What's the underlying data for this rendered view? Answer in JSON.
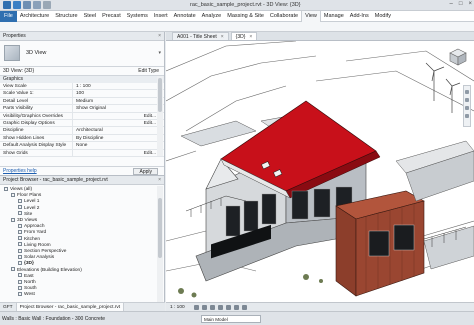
{
  "titlebar": {
    "title": "rac_basic_sample_project.rvt - 3D View: {3D}",
    "qat_colors": [
      "#2f6fb0",
      "#3a7fc4",
      "#6e8fb3",
      "#8aa1ba",
      "#9aa8b6"
    ],
    "win_min": "–",
    "win_max": "□",
    "win_close": "×"
  },
  "ribbon": {
    "tabs": [
      {
        "label": "File"
      },
      {
        "label": "Architecture"
      },
      {
        "label": "Structure"
      },
      {
        "label": "Steel"
      },
      {
        "label": "Precast"
      },
      {
        "label": "Systems"
      },
      {
        "label": "Insert"
      },
      {
        "label": "Annotate"
      },
      {
        "label": "Analyze"
      },
      {
        "label": "Massing & Site"
      },
      {
        "label": "Collaborate"
      },
      {
        "label": "View"
      },
      {
        "label": "Manage"
      },
      {
        "label": "Add-Ins"
      },
      {
        "label": "Modify"
      }
    ]
  },
  "properties": {
    "header": "Properties",
    "close": "×",
    "type_name": "3D View",
    "type_dropdown": "▾",
    "instance_label": "3D View: {3D}",
    "edit_type": "Edit Type",
    "group_graphics": "Graphics",
    "rows": [
      {
        "key": "View Scale",
        "value": "1 : 100"
      },
      {
        "key": "Scale Value 1:",
        "value": "100"
      },
      {
        "key": "Detail Level",
        "value": "Medium"
      },
      {
        "key": "Parts Visibility",
        "value": "Show Original"
      },
      {
        "key": "Visibility/Graphics Overrides",
        "value": "Edit..."
      },
      {
        "key": "Graphic Display Options",
        "value": "Edit..."
      },
      {
        "key": "Discipline",
        "value": "Architectural"
      },
      {
        "key": "Show Hidden Lines",
        "value": "By Discipline"
      },
      {
        "key": "Default Analysis Display Style",
        "value": "None"
      },
      {
        "key": "Show Grids",
        "value": "Edit..."
      }
    ],
    "help_link": "Properties help",
    "apply": "Apply"
  },
  "browser": {
    "header": "Project Browser - rac_basic_sample_project.rvt",
    "close": "×",
    "nodes": [
      {
        "label": "Views (all)",
        "level": 0
      },
      {
        "label": "Floor Plans",
        "level": 1
      },
      {
        "label": "Level 1",
        "level": 2
      },
      {
        "label": "Level 2",
        "level": 2
      },
      {
        "label": "Site",
        "level": 2
      },
      {
        "label": "3D Views",
        "level": 1
      },
      {
        "label": "Approach",
        "level": 2
      },
      {
        "label": "From Yard",
        "level": 2
      },
      {
        "label": "Kitchen",
        "level": 2
      },
      {
        "label": "Living Room",
        "level": 2
      },
      {
        "label": "Section Perspective",
        "level": 2
      },
      {
        "label": "Solar Analysis",
        "level": 2
      },
      {
        "label": "{3D}",
        "level": 2,
        "bold": true
      },
      {
        "label": "Elevations (Building Elevation)",
        "level": 1
      },
      {
        "label": "East",
        "level": 2
      },
      {
        "label": "North",
        "level": 2
      },
      {
        "label": "South",
        "level": 2
      },
      {
        "label": "West",
        "level": 2
      }
    ]
  },
  "bottom_tabs": [
    {
      "label": "GFT",
      "active": false
    },
    {
      "label": "Project Browser - rac_basic_sample_project.rvt",
      "active": true
    }
  ],
  "viewtabs": [
    {
      "label": "A001 - Title Sheet",
      "close": "×",
      "active": false
    },
    {
      "label": "{3D}",
      "close": "×",
      "active": true
    }
  ],
  "viewctrl": {
    "scale": "1 : 100"
  },
  "statusbar": {
    "text": "Walls : Basic Wall : Foundation - 300 Concrete",
    "model": "Main Model"
  },
  "colors": {
    "roof": "#c8101a",
    "cladding": "#9a4631",
    "accent": "#2f6fb0"
  }
}
